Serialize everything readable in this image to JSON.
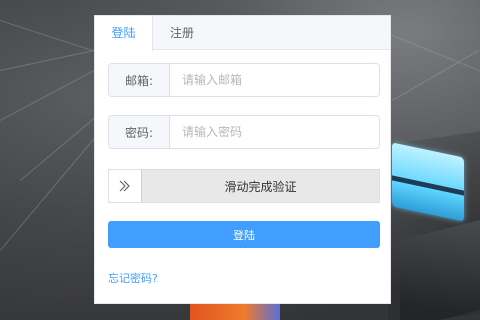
{
  "tabs": [
    {
      "label": "登陆",
      "active": true
    },
    {
      "label": "注册",
      "active": false
    }
  ],
  "form": {
    "email": {
      "label": "邮箱:",
      "placeholder": "请输入邮箱",
      "value": ""
    },
    "password": {
      "label": "密码:",
      "placeholder": "请输入密码",
      "value": ""
    },
    "slider": {
      "text": "滑动完成验证",
      "handle_icon": "double-chevron-right-icon"
    },
    "submit_label": "登陆",
    "forgot_label": "忘记密码?"
  },
  "colors": {
    "accent": "#409eff",
    "background": "#3a3b3d"
  }
}
